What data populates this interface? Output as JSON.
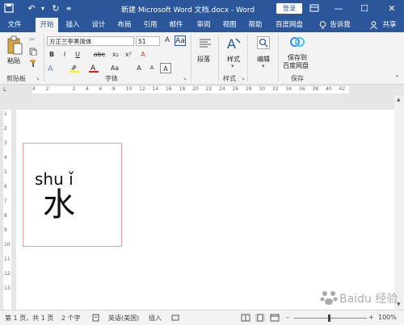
{
  "titlebar": {
    "title": "新建 Microsoft Word 文档.docx - Word",
    "login_label": "登录",
    "min_label": "—",
    "max_label": "☐",
    "close_label": "✕"
  },
  "menu": {
    "file": "文件",
    "home": "开始",
    "insert": "插入",
    "design": "设计",
    "layout": "布局",
    "references": "引用",
    "mailings": "邮件",
    "review": "审阅",
    "view": "视图",
    "help": "帮助",
    "baidu": "百度网盘",
    "tell": "告诉我",
    "share": "共享"
  },
  "ribbon": {
    "clipboard": {
      "paste_label": "粘贴",
      "group_label": "剪贴板"
    },
    "font": {
      "font_name": "方正兰亭黑简体",
      "font_size": "51",
      "bold": "B",
      "italic": "I",
      "underline": "U",
      "strike": "abc",
      "subscript": "x₂",
      "superscript": "x²",
      "grow": "A",
      "shrink": "A",
      "case": "Aa",
      "clear": "A",
      "group_label": "字体"
    },
    "paragraph": {
      "label": "段落"
    },
    "styles": {
      "label": "样式",
      "group_label": "样式"
    },
    "editing": {
      "label": "编辑"
    },
    "save": {
      "line1": "保存到",
      "line2": "百度网盘",
      "group_label": "保存"
    }
  },
  "ruler": {
    "numbers": [
      "4",
      "2",
      "",
      "2",
      "4",
      "6",
      "8",
      "10",
      "12",
      "14",
      "16",
      "18",
      "20",
      "22",
      "24",
      "26",
      "28",
      "30",
      "32",
      "34",
      "36",
      "38",
      "40",
      "42"
    ]
  },
  "vruler": {
    "numbers": [
      "1",
      "2",
      "3",
      "4",
      "5",
      "6",
      "7",
      "8",
      "9",
      "10",
      "11",
      "12",
      "13"
    ]
  },
  "document": {
    "pinyin": "shu ǐ",
    "hanzi": "水"
  },
  "status": {
    "page": "第 1 页，共 1 页",
    "words": "2 个字",
    "language": "英语(美国)",
    "mode": "插入",
    "zoom": "100%"
  },
  "watermark": "Baidu 经验"
}
